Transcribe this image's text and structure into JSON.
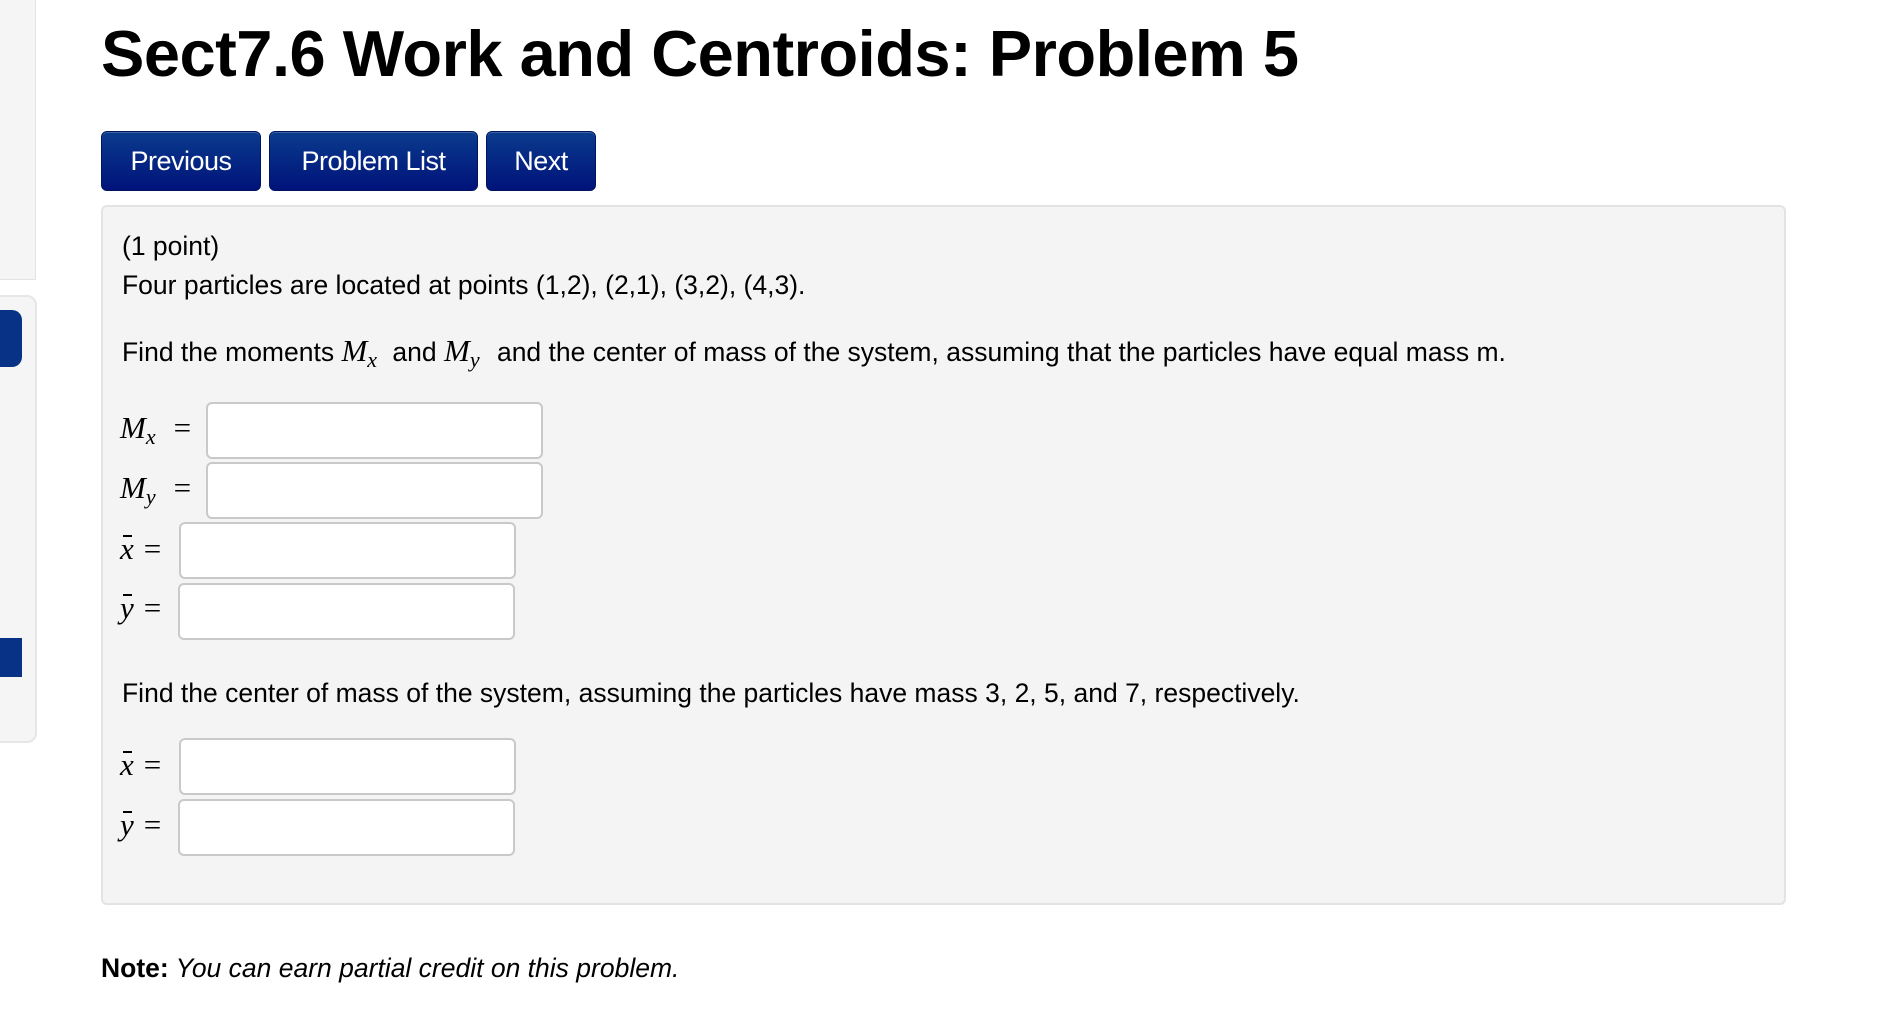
{
  "sidebar": {
    "accent_color": "#073285"
  },
  "header": {
    "title": "Sect7.6 Work and Centroids: Problem 5"
  },
  "nav": {
    "previous_label": "Previous",
    "problem_list_label": "Problem List",
    "next_label": "Next",
    "button_color": "#00167a"
  },
  "problem": {
    "points": "(1 point)",
    "statement": "Four particles are located at points (1,2), (2,1), (3,2), (4,3).",
    "question1": {
      "prefix": "Find the moments ",
      "m1": "M",
      "m1_sub": "x",
      "mid": " and ",
      "m2": "M",
      "m2_sub": "y",
      "suffix": " and the center of mass of the system, assuming that the particles have equal mass m."
    },
    "answers1": [
      {
        "var": "M",
        "sub": "x",
        "eq": "=",
        "value": "",
        "placeholder": ""
      },
      {
        "var": "M",
        "sub": "y",
        "eq": "=",
        "value": "",
        "placeholder": ""
      },
      {
        "var": "x",
        "bar": true,
        "eq": "=",
        "value": "",
        "placeholder": ""
      },
      {
        "var": "y",
        "bar": true,
        "eq": "=",
        "value": "",
        "placeholder": ""
      }
    ],
    "question2": "Find the center of mass of the system, assuming the particles have mass 3, 2, 5, and 7, respectively.",
    "answers2": [
      {
        "var": "x",
        "bar": true,
        "eq": "=",
        "value": "",
        "placeholder": ""
      },
      {
        "var": "y",
        "bar": true,
        "eq": "=",
        "value": "",
        "placeholder": ""
      }
    ]
  },
  "note": {
    "label": "Note:",
    "text": " You can earn partial credit on this problem."
  }
}
